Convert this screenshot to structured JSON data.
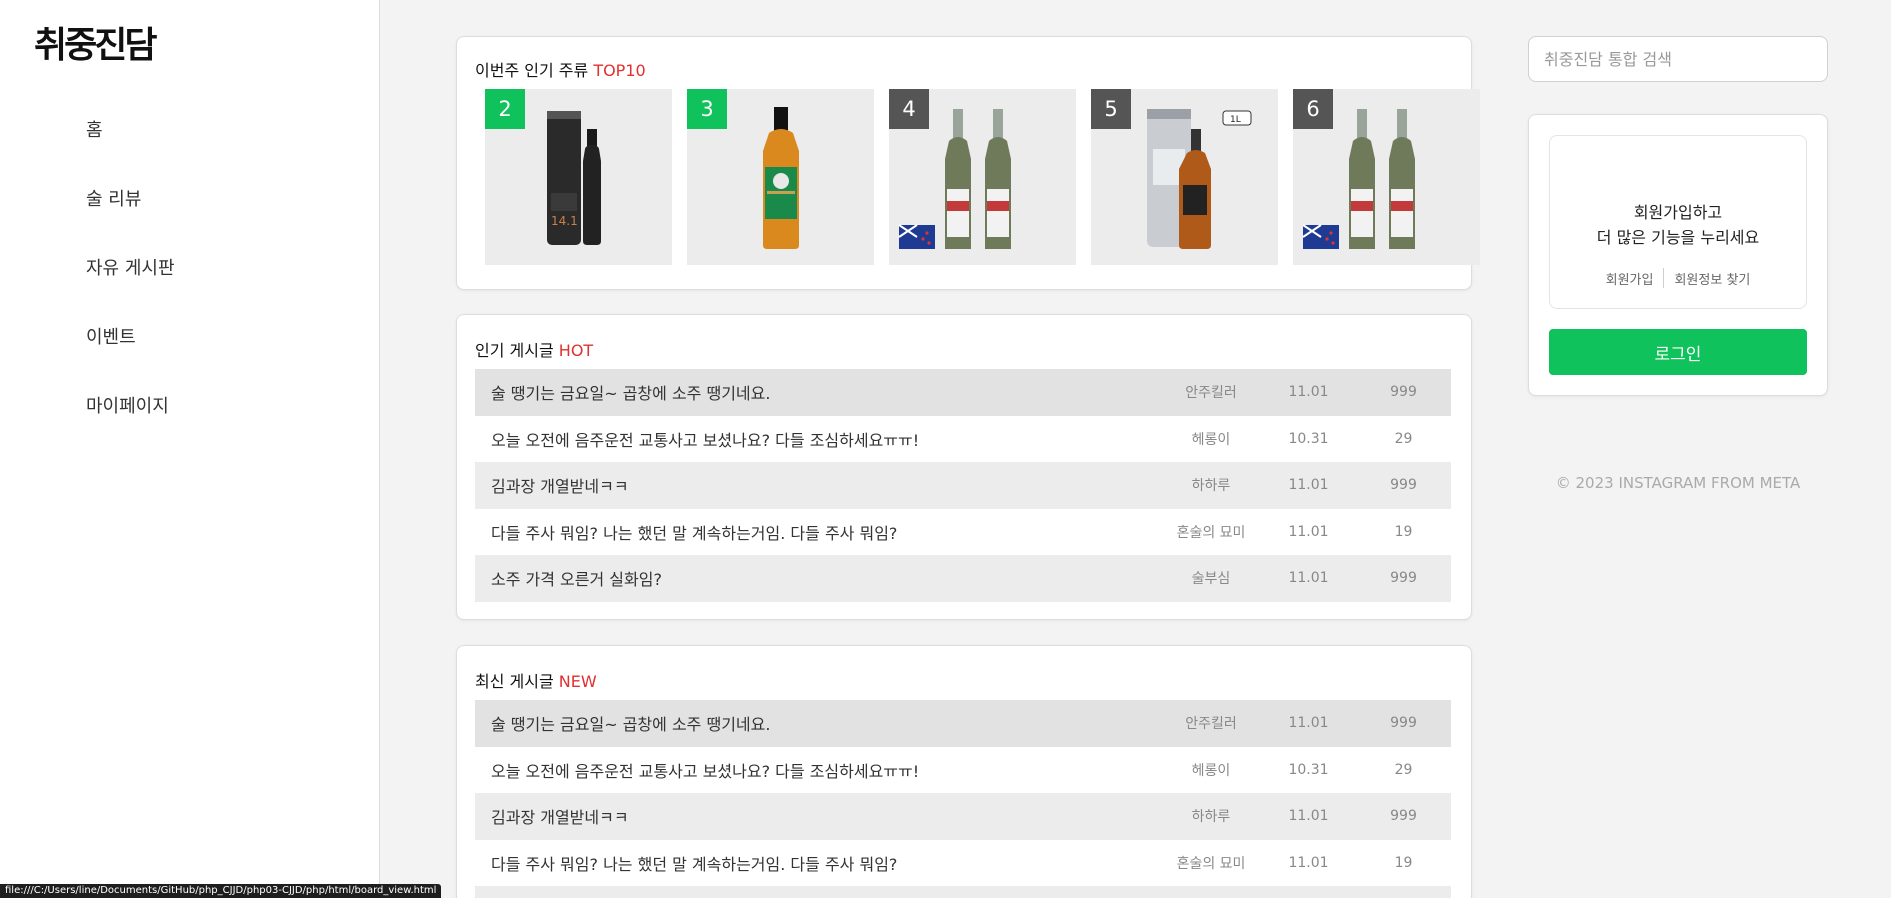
{
  "sidebar": {
    "logo": "취중진담",
    "nav": [
      {
        "label": "홈"
      },
      {
        "label": "술 리뷰"
      },
      {
        "label": "자유 게시판"
      },
      {
        "label": "이벤트"
      },
      {
        "label": "마이페이지"
      }
    ]
  },
  "top10": {
    "title": "이번주 인기 주류",
    "title_accent": "TOP10",
    "items": [
      {
        "rank": "2",
        "badge_color": "#10c25b",
        "kind": "black-bottle-with-tube"
      },
      {
        "rank": "3",
        "badge_color": "#10c25b",
        "kind": "whisky-bottle"
      },
      {
        "rank": "4",
        "badge_color": "#555555",
        "kind": "two-wine-bottles-nz-flag"
      },
      {
        "rank": "5",
        "badge_color": "#555555",
        "kind": "whisky-with-tube",
        "size_label": "1L"
      },
      {
        "rank": "6",
        "badge_color": "#555555",
        "kind": "two-wine-bottles-nz-flag"
      }
    ]
  },
  "hot_posts": {
    "title": "인기 게시글",
    "title_accent": "HOT",
    "rows": [
      {
        "title": "술 땡기는 금요일~ 곱창에 소주 땡기네요.",
        "author": "안주킬러",
        "date": "11.01",
        "count": "999"
      },
      {
        "title": "오늘 오전에 음주운전 교통사고 보셨나요? 다들 조심하세요ㅠㅠ!",
        "author": "헤롱이",
        "date": "10.31",
        "count": "29"
      },
      {
        "title": "김과장 개열받네ㅋㅋ",
        "author": "하하루",
        "date": "11.01",
        "count": "999"
      },
      {
        "title": "다들 주사 뭐임? 나는 했던 말 계속하는거임. 다들 주사 뭐임?",
        "author": "혼술의 묘미",
        "date": "11.01",
        "count": "19"
      },
      {
        "title": "소주 가격 오른거 실화임?",
        "author": "술부심",
        "date": "11.01",
        "count": "999"
      }
    ]
  },
  "new_posts": {
    "title": "최신 게시글",
    "title_accent": "NEW",
    "rows": [
      {
        "title": "술 땡기는 금요일~ 곱창에 소주 땡기네요.",
        "author": "안주킬러",
        "date": "11.01",
        "count": "999"
      },
      {
        "title": "오늘 오전에 음주운전 교통사고 보셨나요? 다들 조심하세요ㅠㅠ!",
        "author": "헤롱이",
        "date": "10.31",
        "count": "29"
      },
      {
        "title": "김과장 개열받네ㅋㅋ",
        "author": "하하루",
        "date": "11.01",
        "count": "999"
      },
      {
        "title": "다들 주사 뭐임? 나는 했던 말 계속하는거임. 다들 주사 뭐임?",
        "author": "혼술의 묘미",
        "date": "11.01",
        "count": "19"
      }
    ]
  },
  "search": {
    "placeholder": "취중진담 통합 검색"
  },
  "login": {
    "promo_line1": "회원가입하고",
    "promo_line2": "더 많은 기능을 누리세요",
    "signup": "회원가입",
    "find_info": "회원정보 찾기",
    "button": "로그인"
  },
  "footer": {
    "copyright": "© 2023 INSTAGRAM FROM META"
  },
  "status_bar": {
    "url": "file:///C:/Users/line/Documents/GitHub/php_CJJD/php03-CJJD/php/html/board_view.html"
  },
  "colors": {
    "accent_green": "#10c25b",
    "accent_red": "#e03030"
  }
}
